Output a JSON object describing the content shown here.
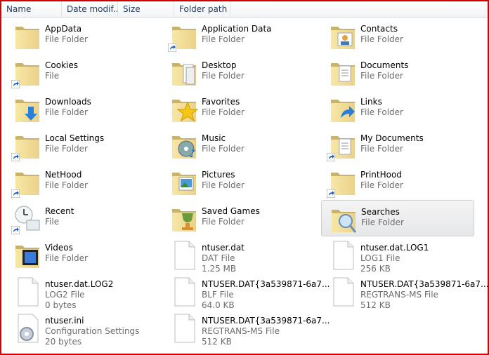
{
  "columns": [
    "Name",
    "Date modif...",
    "Size",
    "Folder path"
  ],
  "items": [
    {
      "name": "AppData",
      "sub": [
        "File Folder"
      ],
      "icon": "folder-icon",
      "shortcut": false
    },
    {
      "name": "Application Data",
      "sub": [
        "File Folder"
      ],
      "icon": "folder-icon",
      "shortcut": true
    },
    {
      "name": "Contacts",
      "sub": [
        "File Folder"
      ],
      "icon": "contacts-folder-icon",
      "shortcut": false
    },
    {
      "name": "Cookies",
      "sub": [
        "File"
      ],
      "icon": "folder-icon",
      "shortcut": true
    },
    {
      "name": "Desktop",
      "sub": [
        "File Folder"
      ],
      "icon": "desktop-folder-icon",
      "shortcut": false
    },
    {
      "name": "Documents",
      "sub": [
        "File Folder"
      ],
      "icon": "documents-folder-icon",
      "shortcut": false
    },
    {
      "name": "Downloads",
      "sub": [
        "File Folder"
      ],
      "icon": "downloads-folder-icon",
      "shortcut": false
    },
    {
      "name": "Favorites",
      "sub": [
        "File Folder"
      ],
      "icon": "favorites-folder-icon",
      "shortcut": false
    },
    {
      "name": "Links",
      "sub": [
        "File Folder"
      ],
      "icon": "links-folder-icon",
      "shortcut": false
    },
    {
      "name": "Local Settings",
      "sub": [
        "File Folder"
      ],
      "icon": "folder-icon",
      "shortcut": true
    },
    {
      "name": "Music",
      "sub": [
        "File Folder"
      ],
      "icon": "music-folder-icon",
      "shortcut": false
    },
    {
      "name": "My Documents",
      "sub": [
        "File Folder"
      ],
      "icon": "documents-folder-icon",
      "shortcut": true
    },
    {
      "name": "NetHood",
      "sub": [
        "File Folder"
      ],
      "icon": "folder-icon",
      "shortcut": true
    },
    {
      "name": "Pictures",
      "sub": [
        "File Folder"
      ],
      "icon": "pictures-folder-icon",
      "shortcut": false
    },
    {
      "name": "PrintHood",
      "sub": [
        "File Folder"
      ],
      "icon": "folder-icon",
      "shortcut": true
    },
    {
      "name": "Recent",
      "sub": [
        "File"
      ],
      "icon": "recent-icon",
      "shortcut": true
    },
    {
      "name": "Saved Games",
      "sub": [
        "File Folder"
      ],
      "icon": "saved-games-folder-icon",
      "shortcut": false
    },
    {
      "name": "Searches",
      "sub": [
        "File Folder"
      ],
      "icon": "searches-folder-icon",
      "shortcut": false,
      "selected": true
    },
    {
      "name": "Videos",
      "sub": [
        "File Folder"
      ],
      "icon": "videos-folder-icon",
      "shortcut": false
    },
    {
      "name": "ntuser.dat",
      "sub": [
        "DAT File",
        "1.25 MB"
      ],
      "icon": "file-icon",
      "shortcut": false
    },
    {
      "name": "ntuser.dat.LOG1",
      "sub": [
        "LOG1 File",
        "256 KB"
      ],
      "icon": "file-icon",
      "shortcut": false
    },
    {
      "name": "ntuser.dat.LOG2",
      "sub": [
        "LOG2 File",
        "0 bytes"
      ],
      "icon": "file-icon",
      "shortcut": false
    },
    {
      "name": "NTUSER.DAT{3a539871-6a7...",
      "sub": [
        "BLF File",
        "64.0 KB"
      ],
      "icon": "file-icon",
      "shortcut": false
    },
    {
      "name": "NTUSER.DAT{3a539871-6a7...",
      "sub": [
        "REGTRANS-MS File",
        "512 KB"
      ],
      "icon": "file-icon",
      "shortcut": false
    },
    {
      "name": "ntuser.ini",
      "sub": [
        "Configuration Settings",
        "20 bytes"
      ],
      "icon": "settings-file-icon",
      "shortcut": false
    },
    {
      "name": "NTUSER.DAT{3a539871-6a7...",
      "sub": [
        "REGTRANS-MS File",
        "512 KB"
      ],
      "icon": "file-icon",
      "shortcut": false
    }
  ],
  "colors": {
    "border": "#d40000",
    "header_text": "#1e395b",
    "sub_text": "#6d6d6d",
    "selection": "#e6e7e9"
  }
}
